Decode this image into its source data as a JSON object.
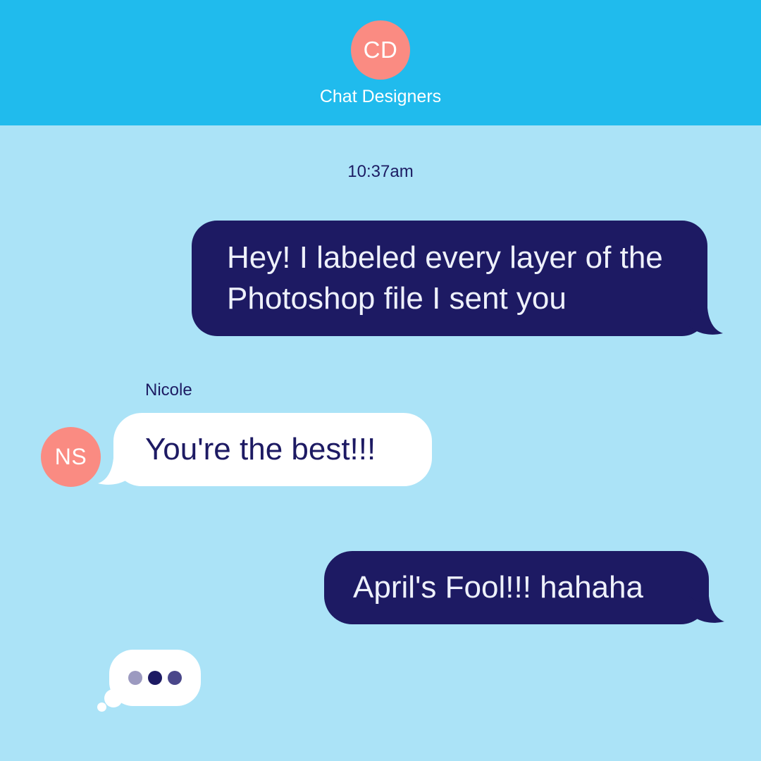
{
  "header": {
    "avatar_initials": "CD",
    "title": "Chat Designers"
  },
  "timestamp": "10:37am",
  "messages": [
    {
      "direction": "outgoing",
      "text": "Hey! I labeled every layer of the Photoshop file I sent you"
    },
    {
      "direction": "incoming",
      "sender_name": "Nicole",
      "sender_initials": "NS",
      "text": "You're the best!!!"
    },
    {
      "direction": "outgoing",
      "text": "April's Fool!!! hahaha"
    }
  ],
  "typing_indicator": {
    "dots": 3
  },
  "colors": {
    "header_bg": "#20bbed",
    "chat_bg": "#abe3f7",
    "outgoing_bubble": "#1d1a63",
    "incoming_bubble": "#ffffff",
    "avatar": "#fa8b82",
    "typing_dot_light": "#9c9ac0",
    "typing_dot_dark": "#1d1a63",
    "typing_dot_mid": "#4a478a"
  }
}
